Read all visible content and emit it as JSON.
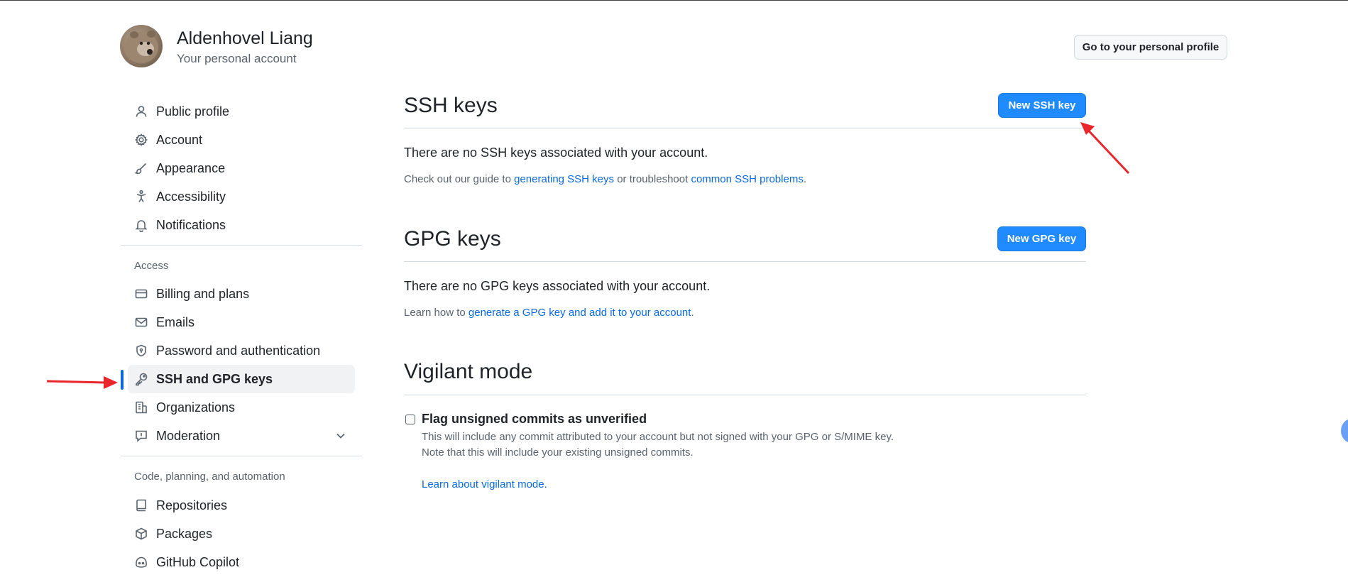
{
  "header": {
    "account_name": "Aldenhovel Liang",
    "account_sub": "Your personal account",
    "profile_button": "Go to your personal profile"
  },
  "sidebar": {
    "items": [
      {
        "label": "Public profile",
        "icon": "person-icon"
      },
      {
        "label": "Account",
        "icon": "gear-icon"
      },
      {
        "label": "Appearance",
        "icon": "paintbrush-icon"
      },
      {
        "label": "Accessibility",
        "icon": "accessibility-icon"
      },
      {
        "label": "Notifications",
        "icon": "bell-icon"
      },
      {
        "label": "Billing and plans",
        "icon": "credit-card-icon"
      },
      {
        "label": "Emails",
        "icon": "mail-icon"
      },
      {
        "label": "Password and authentication",
        "icon": "shield-lock-icon"
      },
      {
        "label": "SSH and GPG keys",
        "icon": "key-icon"
      },
      {
        "label": "Organizations",
        "icon": "organization-icon"
      },
      {
        "label": "Moderation",
        "icon": "report-icon"
      },
      {
        "label": "Repositories",
        "icon": "repo-icon"
      },
      {
        "label": "Packages",
        "icon": "package-icon"
      },
      {
        "label": "GitHub Copilot",
        "icon": "copilot-icon"
      }
    ],
    "heading_access": "Access",
    "heading_code": "Code, planning, and automation"
  },
  "ssh": {
    "title": "SSH keys",
    "button": "New SSH key",
    "empty": "There are no SSH keys associated with your account.",
    "help_prefix": "Check out our guide to ",
    "help_link1": "generating SSH keys",
    "help_mid": " or troubleshoot ",
    "help_link2": "common SSH problems",
    "help_suffix": "."
  },
  "gpg": {
    "title": "GPG keys",
    "button": "New GPG key",
    "empty": "There are no GPG keys associated with your account.",
    "help_prefix": "Learn how to ",
    "help_link": "generate a GPG key and add it to your account",
    "help_suffix": "."
  },
  "vigilant": {
    "title": "Vigilant mode",
    "checkbox_label": "Flag unsigned commits as unverified",
    "desc1": "This will include any commit attributed to your account but not signed with your GPG or S/MIME key.",
    "desc2": "Note that this will include your existing unsigned commits.",
    "link": "Learn about vigilant mode."
  },
  "colors": {
    "accent": "#0969da",
    "button": "#1f8bff",
    "annotation_arrow": "#e8262b"
  }
}
